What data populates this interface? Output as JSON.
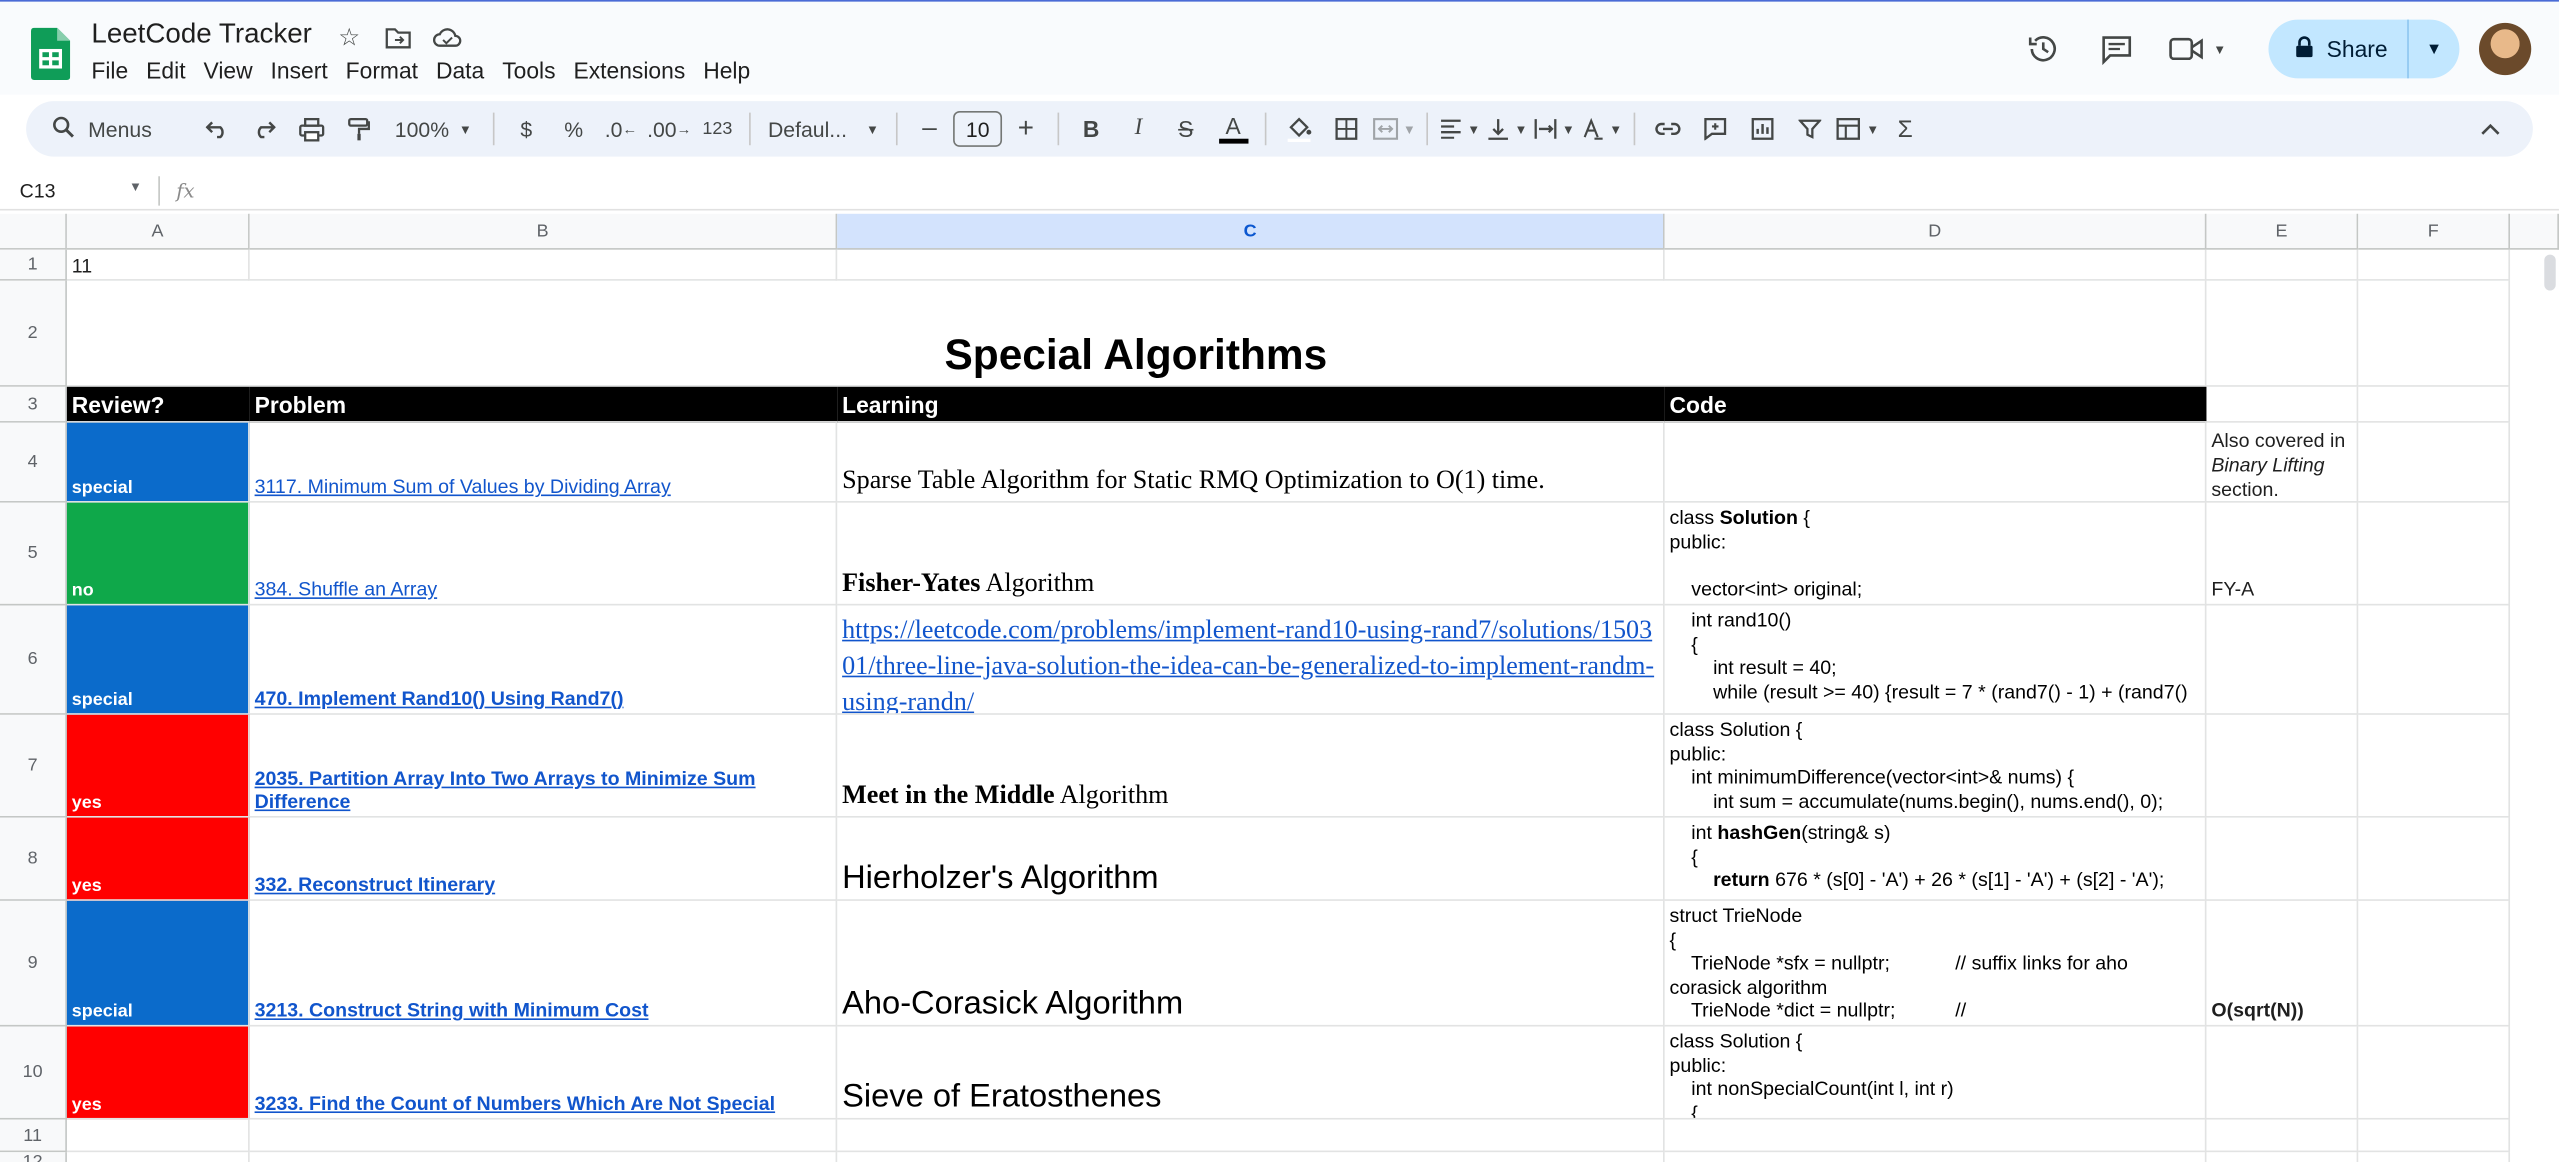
{
  "app": {
    "title": "LeetCode Tracker",
    "menu": [
      "File",
      "Edit",
      "View",
      "Insert",
      "Format",
      "Data",
      "Tools",
      "Extensions",
      "Help"
    ],
    "share_label": "Share",
    "colors": {
      "accent": "#0b57d0",
      "share_bg": "#c2e7ff",
      "sheets_green": "#0f9d58"
    }
  },
  "toolbar": {
    "search_label": "Menus",
    "zoom": "100%",
    "currency": "$",
    "percent": "%",
    "dec_decrease": ".0",
    "dec_increase": ".00",
    "number_format": "123",
    "font": "Defaul...",
    "font_size": "10"
  },
  "formula": {
    "cell_ref": "C13",
    "fx": "fx",
    "content": ""
  },
  "columns": [
    "A",
    "B",
    "C",
    "D",
    "E",
    "F"
  ],
  "rows": [
    "1",
    "2",
    "3",
    "4",
    "5",
    "6",
    "7",
    "8",
    "9",
    "10",
    "11",
    "12"
  ],
  "sheet": {
    "a1": "11",
    "title": "Special Algorithms",
    "headers": {
      "review": "Review?",
      "problem": "Problem",
      "learning": "Learning",
      "code": "Code"
    },
    "entries": [
      {
        "review": "special",
        "review_color": "#0b6bcb",
        "problem": "3117. Minimum Sum of Values by Dividing Array",
        "learning": "Sparse Table Algorithm for Static RMQ Optimization to O(1) time.",
        "code": "",
        "note_pre": "Also covered in ",
        "note_em": "Binary Lifting",
        "note_post": " section."
      },
      {
        "review": "no",
        "review_color": "#0fa84a",
        "problem": "384. Shuffle an Array",
        "learning_bold": "Fisher-Yates",
        "learning": " Algorithm",
        "code_l1": "class ",
        "code_l1b": "Solution",
        "code_l1c": " {",
        "code_l2": "public:",
        "code_l3": "",
        "code_l4": "    vector<int> original;",
        "note": "FY-A"
      },
      {
        "review": "special",
        "review_color": "#0b6bcb",
        "problem": "470. Implement Rand10() Using Rand7()",
        "learning_link": "https://leetcode.com/problems/implement-rand10-using-rand7/solutions/150301/three-line-java-solution-the-idea-can-be-generalized-to-implement-randm-using-randn/",
        "code_l1": "    int rand10()",
        "code_l2": "    {",
        "code_l3": "        int result = 40;",
        "code_l4": "        while (result >= 40) {result = 7 * (rand7() - 1) + (rand7()"
      },
      {
        "review": "yes",
        "review_color": "#ff0000",
        "problem": "2035. Partition Array Into Two Arrays to Minimize Sum Difference",
        "learning_bold": "Meet in the Middle",
        "learning": " Algorithm",
        "code_l1": "class Solution {",
        "code_l2": "public:",
        "code_l3": "    int minimumDifference(vector<int>& nums) {",
        "code_l4": "        int sum = accumulate(nums.begin(), nums.end(), 0);"
      },
      {
        "review": "yes",
        "review_color": "#ff0000",
        "problem": "332. Reconstruct Itinerary",
        "learning": "Hierholzer's Algorithm",
        "code_l1a": "    int ",
        "code_l1b": "hashGen",
        "code_l1c": "(string& s)",
        "code_l2": "    {",
        "code_l3b": "        return",
        "code_l3": " 676 * (s[0] - 'A') + 26 * (s[1] - 'A') + (s[2] - 'A');"
      },
      {
        "review": "special",
        "review_color": "#0b6bcb",
        "problem": "3213. Construct String with Minimum Cost",
        "learning": "Aho-Corasick Algorithm",
        "code_l1": "struct TrieNode",
        "code_l2": "{",
        "code_l3": "    TrieNode *sfx = nullptr;            // suffix links for aho",
        "code_l4": "corasick algorithm",
        "code_l5": "    TrieNode *dict = nullptr;           //",
        "note": "O(sqrt(N))"
      },
      {
        "review": "yes",
        "review_color": "#ff0000",
        "problem": "3233. Find the Count of Numbers Which Are Not Special",
        "learning": "Sieve of Eratosthenes",
        "code_l1": "class Solution {",
        "code_l2": "public:",
        "code_l3": "    int nonSpecialCount(int l, int r)",
        "code_l4": "    {"
      }
    ]
  }
}
